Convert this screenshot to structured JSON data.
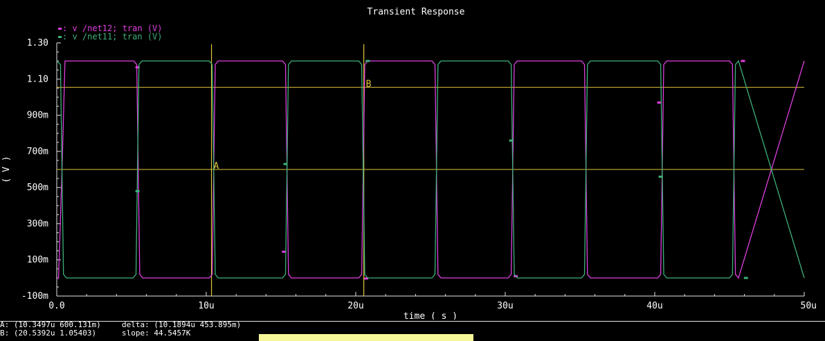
{
  "chart_data": {
    "type": "line",
    "title": "Transient Response",
    "xlabel": "time ( s )",
    "ylabel": "( V )",
    "xlim": [
      0,
      50
    ],
    "ylim": [
      -100,
      1300
    ],
    "x_unit_scale": "u",
    "xticks": [
      0,
      10,
      20,
      30,
      40,
      50
    ],
    "xtick_labels": [
      "0.0",
      "10u",
      "20u",
      "30u",
      "40u",
      "50u"
    ],
    "yticks": [
      -100,
      100,
      300,
      500,
      700,
      900,
      1100,
      1300
    ],
    "ytick_labels": [
      "-100m",
      "100m",
      "300m",
      "500m",
      "700m",
      "900m",
      "1.10",
      "1.30"
    ],
    "series": [
      {
        "name": "v /net12; tran (V)",
        "legend_label": "v /net12; tran (V)",
        "color": "#e040e0",
        "x": [
          0.0,
          0.12,
          0.35,
          0.55,
          5.15,
          5.35,
          5.55,
          5.75,
          10.2,
          10.4,
          10.6,
          10.8,
          15.1,
          15.3,
          15.5,
          15.7,
          20.2,
          20.4,
          20.6,
          20.8,
          25.1,
          25.3,
          25.5,
          25.7,
          30.2,
          30.4,
          30.6,
          30.8,
          35.1,
          35.3,
          35.5,
          35.7,
          40.2,
          40.4,
          40.6,
          40.8,
          45.0,
          45.2,
          45.4,
          45.6,
          50.0
        ],
        "values": [
          -3,
          0,
          600,
          1200,
          1200,
          1180,
          20,
          0,
          0,
          20,
          1180,
          1200,
          1200,
          1180,
          20,
          0,
          0,
          20,
          1180,
          1200,
          1200,
          1180,
          20,
          0,
          0,
          20,
          1180,
          1200,
          1200,
          1180,
          20,
          0,
          0,
          20,
          1180,
          1200,
          1200,
          1180,
          20,
          0,
          1200
        ],
        "markers": [
          {
            "x": 5.4,
            "y": 1165
          },
          {
            "x": 15.2,
            "y": 145
          },
          {
            "x": 20.7,
            "y": -3
          },
          {
            "x": 30.7,
            "y": 10
          },
          {
            "x": 40.3,
            "y": 970
          },
          {
            "x": 45.9,
            "y": 1200
          }
        ]
      },
      {
        "name": "v /net11; tran (V)",
        "legend_label": "v /net11; tran (V)",
        "color": "#3fb17a",
        "x": [
          0.0,
          0.25,
          0.45,
          0.65,
          5.1,
          5.3,
          5.5,
          5.7,
          10.2,
          10.4,
          10.6,
          10.8,
          15.1,
          15.3,
          15.5,
          15.7,
          20.2,
          20.4,
          20.6,
          20.8,
          25.1,
          25.3,
          25.5,
          25.7,
          30.2,
          30.4,
          30.6,
          30.8,
          35.1,
          35.3,
          35.5,
          35.7,
          40.2,
          40.4,
          40.6,
          40.8,
          45.0,
          45.2,
          45.4,
          45.6,
          50.0
        ],
        "values": [
          1200,
          1180,
          20,
          0,
          0,
          20,
          1180,
          1200,
          1200,
          1180,
          20,
          0,
          0,
          20,
          1180,
          1200,
          1200,
          1180,
          20,
          0,
          0,
          20,
          1180,
          1200,
          1200,
          1180,
          20,
          0,
          0,
          20,
          1180,
          1200,
          1200,
          1180,
          20,
          0,
          0,
          20,
          1180,
          1200,
          0
        ],
        "markers": [
          {
            "x": 5.4,
            "y": 480
          },
          {
            "x": 15.3,
            "y": 630
          },
          {
            "x": 20.8,
            "y": 1200
          },
          {
            "x": 30.4,
            "y": 760
          },
          {
            "x": 40.4,
            "y": 560
          },
          {
            "x": 46.1,
            "y": 0
          }
        ]
      }
    ],
    "cursors": {
      "vertical": [
        {
          "x": 10.3497,
          "label": "",
          "color": "#e3c73a"
        },
        {
          "x": 20.5392,
          "label": "",
          "color": "#e3c73a"
        }
      ],
      "horizontal": [
        {
          "y": 600.131,
          "label": "A",
          "label_x": 10.3497,
          "color": "#e3c73a"
        },
        {
          "y": 1054.03,
          "label": "B",
          "label_x": 20.5392,
          "color": "#e3c73a"
        }
      ]
    },
    "grid": false,
    "legend_position": "top-left"
  },
  "status": {
    "cursor_a": "A: (10.3497u 600.131m)",
    "cursor_b": "B: (20.5392u 1.05403)",
    "delta": "delta: (10.1894u 453.895m)",
    "slope": "slope: 44.5457K"
  },
  "colors": {
    "background": "#000000",
    "axis": "#e6e6e6",
    "text": "#ffffff",
    "cursor": "#e3c73a"
  }
}
